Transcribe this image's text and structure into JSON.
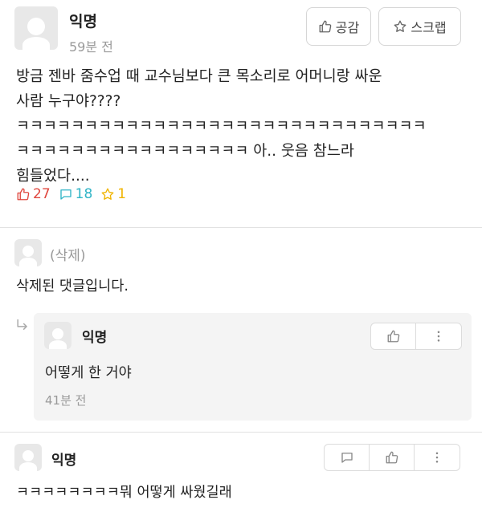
{
  "post": {
    "author": "익명",
    "time": "59분 전",
    "buttons": {
      "empathy": "공감",
      "scrap": "스크랩"
    },
    "lines": [
      "방금 젠바 줌수업 때 교수님보다 큰 목소리로 어머니랑 싸운",
      "사람 누구야????",
      "ㅋㅋㅋㅋㅋㅋㅋㅋㅋㅋㅋㅋㅋㅋㅋㅋㅋㅋㅋㅋㅋㅋㅋㅋㅋㅋㅋㅋㅋㅋ",
      "ㅋㅋㅋㅋㅋㅋㅋㅋㅋㅋㅋㅋㅋㅋㅋㅋㅋ 아.. 웃음 참느라",
      "힘들었다...."
    ],
    "stats": {
      "likes": "27",
      "comments": "18",
      "scraps": "1"
    },
    "colors": {
      "like": "#e0473e",
      "comment": "#2fb4c6",
      "scrap": "#f0b400"
    }
  },
  "comments": [
    {
      "author": "(삭제)",
      "text": "삭제된 댓글입니다."
    },
    {
      "author": "익명",
      "text": "ㅋㅋㅋㅋㅋㅋㅋㅋ뭐 어떻게 싸웠길래"
    }
  ],
  "reply": {
    "author": "익명",
    "text": "어떻게 한 거야",
    "time": "41분 전"
  },
  "icons": {
    "reply_arrow": "reply-arrow-icon",
    "thumbs_up": "thumbs-up-icon",
    "more": "more-vertical-icon",
    "comment": "comment-icon",
    "star": "star-icon"
  }
}
